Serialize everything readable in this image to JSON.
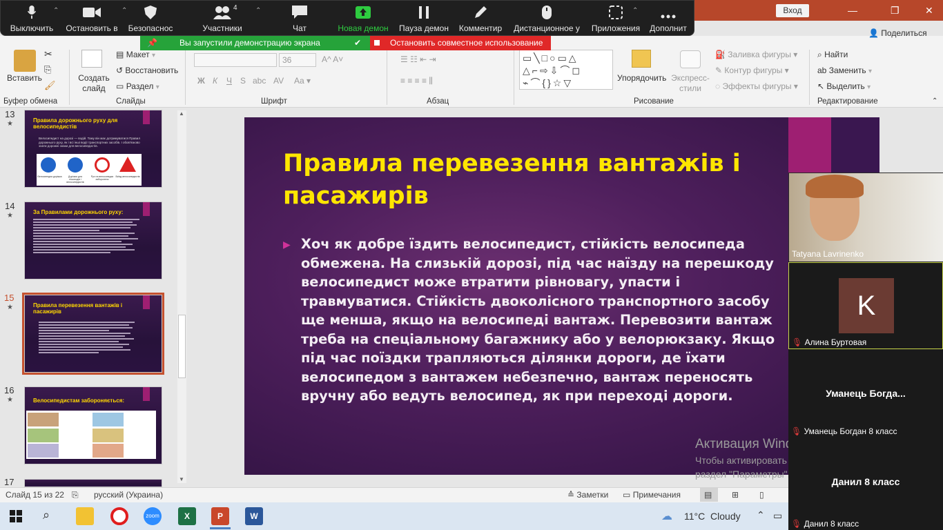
{
  "titlebar": {
    "sign_in": "Вход",
    "minimize": "—",
    "restore": "❐",
    "close": "✕",
    "share_label": "Поделиться"
  },
  "zoom": {
    "items": [
      {
        "label": "Выключить"
      },
      {
        "label": "Остановить в"
      },
      {
        "label": "Безопаснос"
      },
      {
        "label": "Участники",
        "badge": "4"
      },
      {
        "label": "Чат"
      },
      {
        "label": "Новая демон"
      },
      {
        "label": "Пауза демон"
      },
      {
        "label": "Комментир"
      },
      {
        "label": "Дистанционное у"
      },
      {
        "label": "Приложения"
      },
      {
        "label": "Дополнит"
      }
    ],
    "sharing_notice": "Вы запустили демонстрацию экрана",
    "stop_sharing": "Остановить совместное использование"
  },
  "ribbon": {
    "paste": "Вставить",
    "create_slide": "Создать слайд",
    "layout": "Макет",
    "restore": "Восстановить",
    "section": "Раздел",
    "font_size": "36",
    "bold": "Ж",
    "italic": "К",
    "underline": "Ч",
    "strike": "S",
    "shadow": "abc",
    "spacing": "AV",
    "arrange": "Упорядочить",
    "quick_styles": "Экспресс-стили",
    "shape_fill": "Заливка фигуры",
    "shape_outline": "Контур фигуры",
    "shape_effects": "Эффекты фигуры",
    "find": "Найти",
    "replace": "Заменить",
    "select": "Выделить",
    "groups": {
      "clipboard": "Буфер обмена",
      "slides": "Слайды",
      "font": "Шрифт",
      "paragraph": "Абзац",
      "drawing": "Рисование",
      "editing": "Редактирование"
    }
  },
  "thumbnails": [
    {
      "num": "13",
      "star": "★",
      "title": "Правила дорожнього руху для велосипедистів",
      "lines": [
        "Велосипедист на дорозі — водій. Тому він має дотримуватися Правил дорожнього руху, як і всі інші водії транспортних засобів. І обов'язково знати дорожні знаки для велосипедистів."
      ],
      "signs": [
        "Велосипедна доріжка",
        "Доріжка для пішоходів і велосипедистів",
        "Рух на велосипедах заборонено",
        "Виїзд велосипедистів"
      ]
    },
    {
      "num": "14",
      "star": "★",
      "title": "За Правилами дорожнього руху:"
    },
    {
      "num": "15",
      "star": "★",
      "title": "Правила перевезення вантажів і пасажирів",
      "selected": true
    },
    {
      "num": "16",
      "star": "★",
      "title": "Велосипедистам забороняється:"
    },
    {
      "num": "17",
      "star": ""
    }
  ],
  "slide": {
    "title": "Правила перевезення вантажів і пасажирів",
    "body": "Хоч як добре їздить велосипедист, стійкість велосипеда обмежена. На слизькій дорозі, під час наїзду на перешкоду велосипедист може втратити рівновагу, упасти і травмуватися. Стійкість двоколісного транспортного засобу ще менша, якщо на велосипеді вантаж. Перевозити вантаж треба на спеціальному багажнику або у велорюкзаку. Якщо під час поїздки трапляються ділянки дороги, де їхати велосипедом з вантажем небезпечно, вантаж переносять вручну або ведуть велосипед, як при переході дороги."
  },
  "activation": {
    "title": "Активация Windows",
    "subtitle": "Чтобы активировать Windows, перейдите в раздел \"Параметры\"."
  },
  "participants": [
    {
      "name": "Tatyana Lavrinenko",
      "video": true
    },
    {
      "name": "Алина Буртовая",
      "initial": "K",
      "muted": true
    },
    {
      "display": "Уманець  Богда...",
      "name": "Уманець Богдан 8 класс",
      "muted": true
    },
    {
      "display": "Данил 8 класс",
      "name": "Данил 8 класс",
      "muted": true
    }
  ],
  "statusbar": {
    "slide_of": "Слайд 15 из 22",
    "language": "русский (Украина)",
    "notes": "Заметки",
    "comments": "Примечания"
  },
  "taskbar": {
    "temp": "11°C",
    "weather": "Cloudy"
  },
  "colors": {
    "accent": "#b7472a",
    "zoom_bg": "#1f1f1f",
    "share_green": "#26a33a",
    "stop_red": "#e02828",
    "slide_title": "#ffe600"
  }
}
